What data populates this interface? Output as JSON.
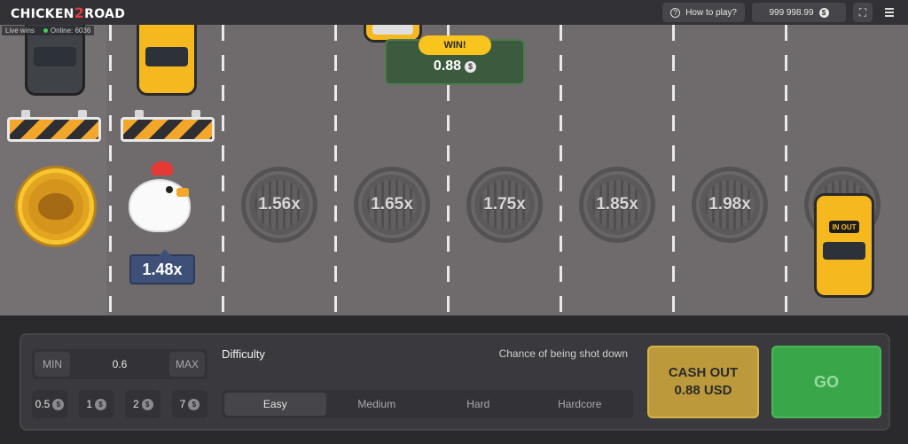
{
  "header": {
    "logo_left": "CHICKEN",
    "logo_mid": "2",
    "logo_right": "ROAD",
    "how_to_play": "How to play?",
    "balance": "999 998.99",
    "currency_symbol": "$"
  },
  "live": {
    "live_wins": "Live wins",
    "online": "Online: 6036"
  },
  "road": {
    "lanes": [
      {
        "multiplier": "1.56x"
      },
      {
        "multiplier": "1.65x"
      },
      {
        "multiplier": "1.75x"
      },
      {
        "multiplier": "1.85x"
      },
      {
        "multiplier": "1.98x"
      }
    ],
    "current_multiplier": "1.48x",
    "car_sign": "IN OUT",
    "win": {
      "label": "WIN!",
      "amount": "0.88"
    }
  },
  "controls": {
    "min_label": "MIN",
    "max_label": "MAX",
    "bet_value": "0.6",
    "quick_bets": [
      "0.5",
      "1",
      "2",
      "7"
    ],
    "difficulty_label": "Difficulty",
    "chance_label": "Chance of being shot down",
    "difficulties": [
      "Easy",
      "Medium",
      "Hard",
      "Hardcore"
    ],
    "active_difficulty": "Easy",
    "cashout_line1": "CASH OUT",
    "cashout_line2": "0.88 USD",
    "go_label": "GO"
  },
  "colors": {
    "road": "#6f6b6d",
    "cashout": "#bc9a3c",
    "go": "#3aa64a",
    "win_badge": "#f8c41d",
    "multiplier_tag": "#3f5078"
  }
}
